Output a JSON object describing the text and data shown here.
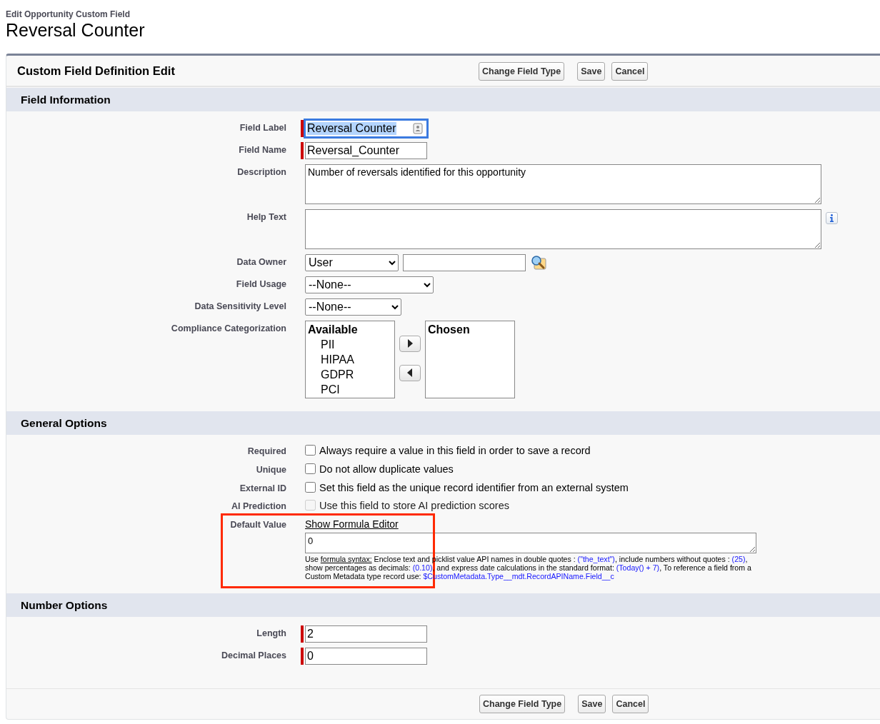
{
  "header": {
    "subtitle": "Edit Opportunity Custom Field",
    "title": "Reversal Counter"
  },
  "panel": {
    "title": "Custom Field Definition Edit",
    "buttons": [
      "Change Field Type",
      "Save",
      "Cancel"
    ]
  },
  "sections": [
    {
      "title": "Field Information",
      "rows": [
        {
          "kind": "text",
          "label": "Field Label",
          "value": "Reversal Counter",
          "required": true,
          "focused": true
        },
        {
          "kind": "text",
          "label": "Field Name",
          "value": "Reversal_Counter",
          "required": true,
          "focused": false
        },
        {
          "kind": "textarea",
          "label": "Description",
          "value": "Number of reversals identified for this opportunity",
          "info": false
        },
        {
          "kind": "textarea",
          "label": "Help Text",
          "value": "",
          "info": true
        },
        {
          "kind": "lookup",
          "label": "Data Owner",
          "value": "User"
        },
        {
          "kind": "select",
          "label": "Field Usage",
          "value": "--None--",
          "wide": true
        },
        {
          "kind": "select",
          "label": "Data Sensitivity Level",
          "value": "--None--",
          "wide": false
        },
        {
          "kind": "duallist",
          "label": "Compliance Categorization",
          "available_title": "Available",
          "available": [
            "PII",
            "HIPAA",
            "GDPR",
            "PCI"
          ],
          "chosen_title": "Chosen"
        }
      ]
    },
    {
      "title": "General Options",
      "rows": [
        {
          "kind": "checkbox",
          "label": "Required",
          "text": "Always require a value in this field in order to save a record",
          "checked": false,
          "disabled": false
        },
        {
          "kind": "checkbox",
          "label": "Unique",
          "text": "Do not allow duplicate values",
          "checked": false,
          "disabled": false
        },
        {
          "kind": "checkbox",
          "label": "External ID",
          "text": "Set this field as the unique record identifier from an external system",
          "checked": false,
          "disabled": false
        },
        {
          "kind": "checkbox",
          "label": "AI Prediction",
          "text": "Use this field to store AI prediction scores",
          "checked": false,
          "disabled": true
        },
        {
          "kind": "formula",
          "label": "Default Value",
          "link": "Show Formula Editor",
          "value": "0",
          "highlighted": true,
          "hint": [
            {
              "kind": "plain",
              "text": "Use "
            },
            {
              "kind": "link",
              "text": "formula syntax:"
            },
            {
              "kind": "plain",
              "text": " Enclose text and picklist value API names in double quotes : "
            },
            {
              "kind": "code",
              "text": "(\"the_text\")"
            },
            {
              "kind": "plain",
              "text": ", include numbers without quotes : "
            },
            {
              "kind": "code",
              "text": "(25)"
            },
            {
              "kind": "plain",
              "text": ", show percentages as decimals: "
            },
            {
              "kind": "code",
              "text": "(0.10)"
            },
            {
              "kind": "plain",
              "text": ", and express date calculations in the standard format: "
            },
            {
              "kind": "code",
              "text": "(Today() + 7)"
            },
            {
              "kind": "plain",
              "text": ", To reference a field from a Custom Metadata type record use: "
            },
            {
              "kind": "code",
              "text": "$CustomMetadata.Type__mdt.RecordAPIName.Field__c"
            }
          ]
        }
      ]
    },
    {
      "title": "Number Options",
      "rows": [
        {
          "kind": "text",
          "label": "Length",
          "value": "2",
          "required": true,
          "focused": false
        },
        {
          "kind": "text",
          "label": "Decimal Places",
          "value": "0",
          "required": true,
          "focused": false
        }
      ]
    }
  ],
  "footer_buttons": [
    "Change Field Type",
    "Save",
    "Cancel"
  ]
}
